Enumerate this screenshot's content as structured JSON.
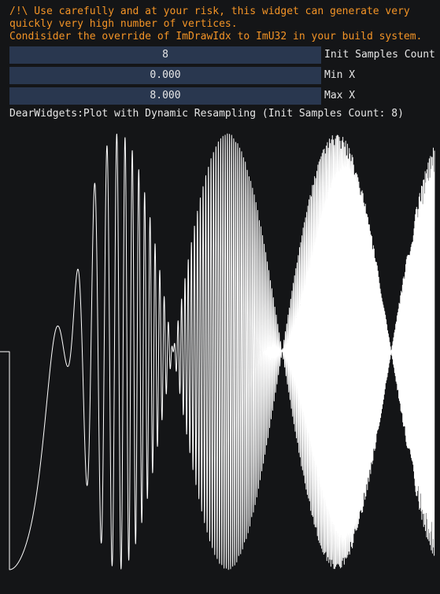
{
  "warning": {
    "line1": "/!\\ Use carefully and at your risk, this widget can generate very",
    "line2": "quickly very high number of vertices.",
    "line3": "Condisider the override of ImDrawIdx to ImU32 in your build system."
  },
  "controls": [
    {
      "value": "8",
      "label": "Init Samples Count"
    },
    {
      "value": "0.000",
      "label": "Min X"
    },
    {
      "value": "8.000",
      "label": "Max X"
    }
  ],
  "plot": {
    "title": "DearWidgets:Plot with Dynamic Resampling (Init Samples Count: 8)",
    "line_color": "#ffffff"
  },
  "colors": {
    "background": "#141517",
    "warning_text": "#f39426",
    "field_bg": "#29374f"
  }
}
